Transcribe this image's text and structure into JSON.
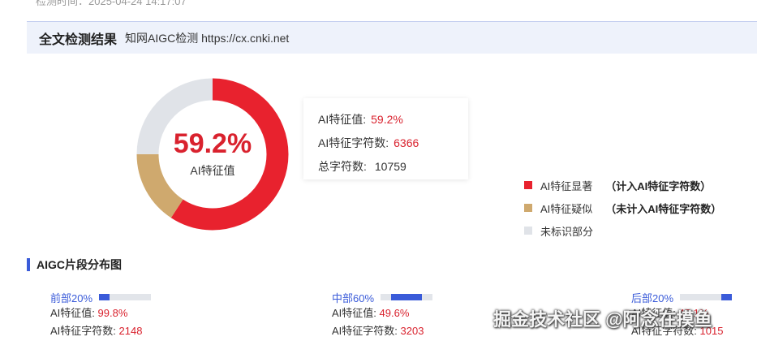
{
  "colors": {
    "ai_significant": "#e8222e",
    "ai_suspected": "#cfa96e",
    "unmarked": "#e0e3e8",
    "accent_blue": "#3a5bd9"
  },
  "top_text": "检测时间：2025-04-24 14:17:07",
  "header": {
    "title": "全文检测结果",
    "subtitle": "知网AIGC检测 https://cx.cnki.net"
  },
  "donut": {
    "percent_text": "59.2%",
    "label": "AI特征值",
    "slices": [
      {
        "name": "AI特征显著",
        "fraction": 0.592
      },
      {
        "name": "AI特征疑似",
        "fraction": 0.158
      },
      {
        "name": "未标识部分",
        "fraction": 0.25
      }
    ]
  },
  "stats": {
    "ai_value_label": "AI特征值:",
    "ai_value": "59.2%",
    "ai_chars_label": "AI特征字符数:",
    "ai_chars": "6366",
    "total_chars_label": "总字符数:",
    "total_chars": "10759"
  },
  "legend": [
    {
      "label": "AI特征显著",
      "note": "（计入AI特征字符数）"
    },
    {
      "label": "AI特征疑似",
      "note": "（未计入AI特征字符数）"
    },
    {
      "label": "未标识部分",
      "note": ""
    }
  ],
  "section": {
    "title": "AIGC片段分布图"
  },
  "segments": [
    {
      "head": "前部20%",
      "range_start": 0.0,
      "range_end": 0.2,
      "ai_value_label": "AI特征值:",
      "ai_value": "99.8%",
      "ai_chars_label": "AI特征字符数:",
      "ai_chars": "2148"
    },
    {
      "head": "中部60%",
      "range_start": 0.2,
      "range_end": 0.8,
      "ai_value_label": "AI特征值:",
      "ai_value": "49.6%",
      "ai_chars_label": "AI特征字符数:",
      "ai_chars": "3203"
    },
    {
      "head": "后部20%",
      "range_start": 0.8,
      "range_end": 1.0,
      "ai_value_label": "AI特征值:",
      "ai_value": "47.1%",
      "ai_chars_label": "AI特征字符数:",
      "ai_chars": "1015"
    }
  ],
  "watermark": "掘金技术社区 @阿念在摸鱼"
}
